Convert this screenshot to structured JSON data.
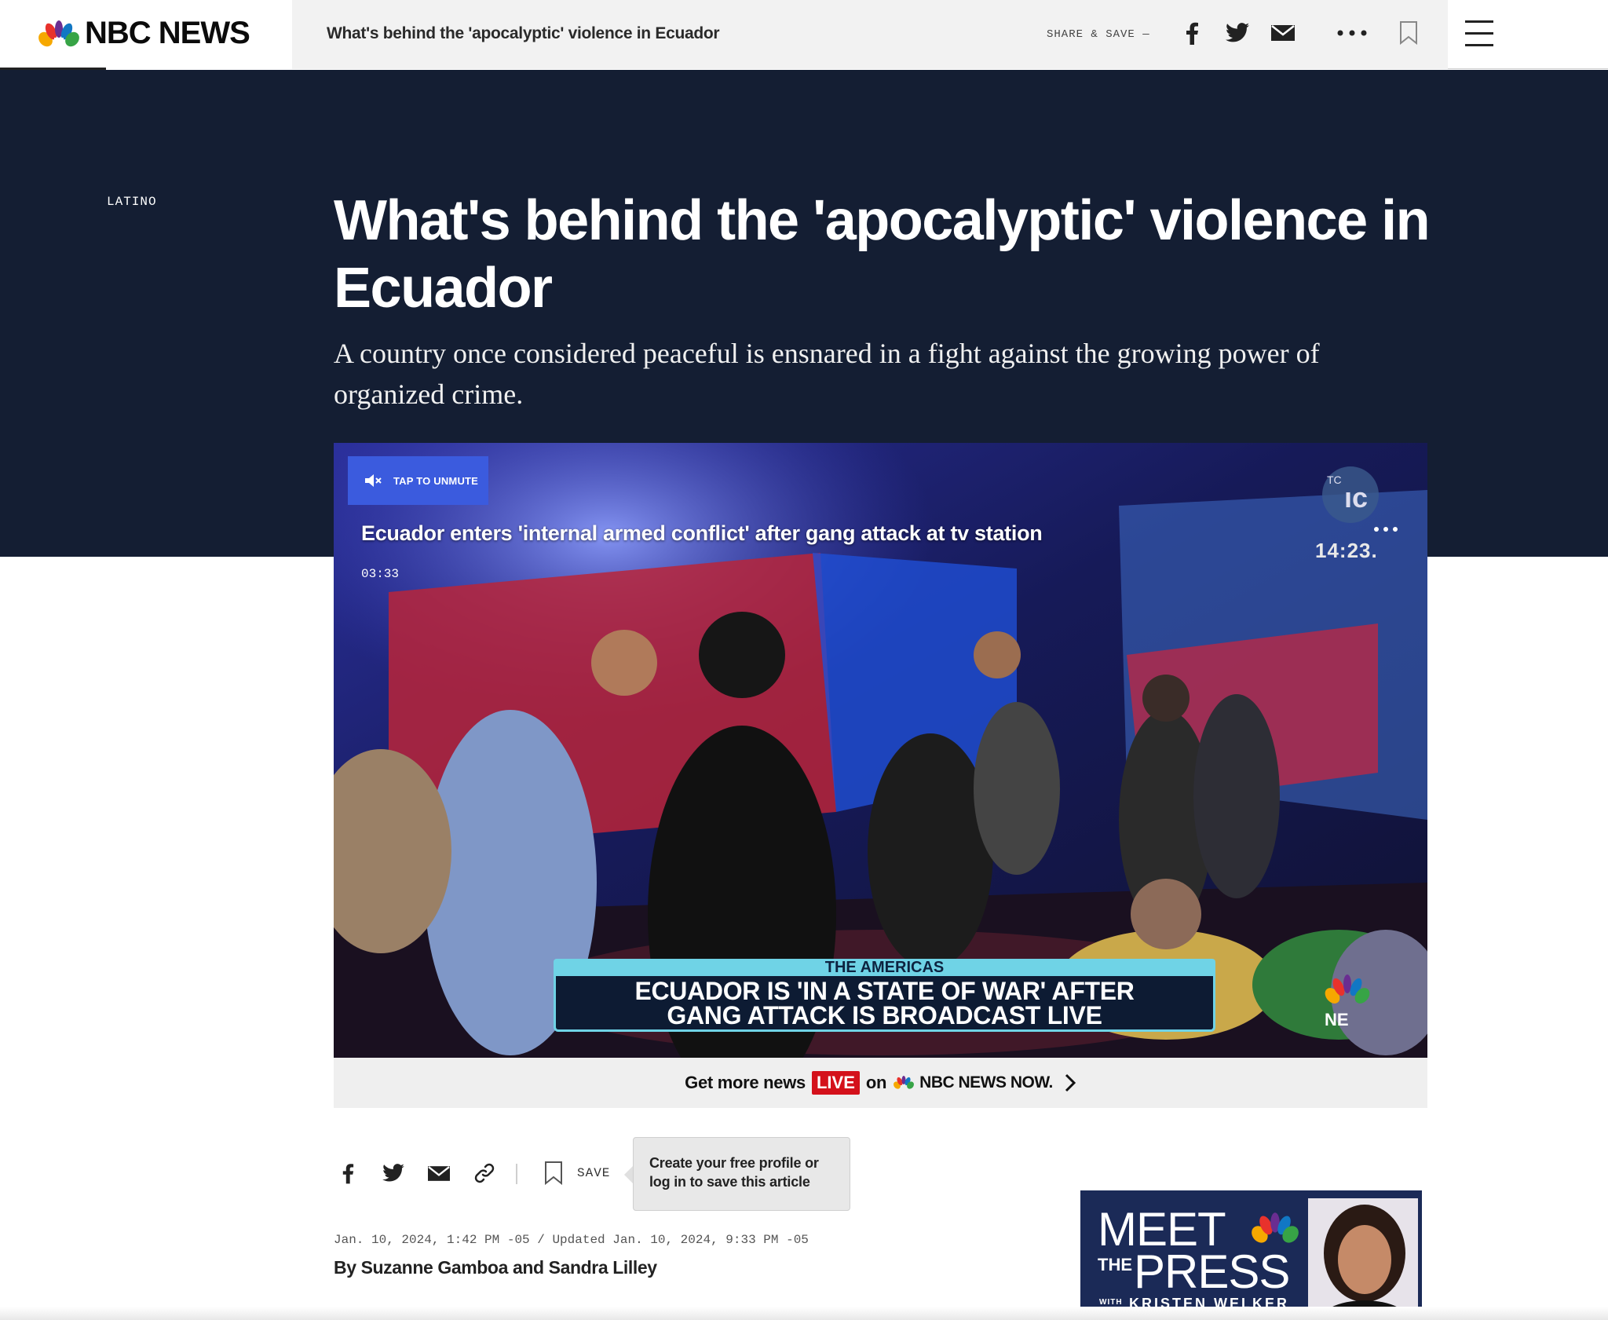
{
  "header": {
    "logo_text": "NBC NEWS",
    "sticky_title": "What's behind the 'apocalyptic' violence in Ecuador",
    "share_label": "SHARE & SAVE —",
    "icons": [
      "facebook-icon",
      "twitter-icon",
      "mail-icon",
      "more-icon",
      "bookmark-icon",
      "hamburger-menu-icon"
    ]
  },
  "article": {
    "section": "LATINO",
    "headline": "What's behind the 'apocalyptic' violence in Ecuador",
    "dek": "A country once considered peaceful is ensnared in a fight against the growing power of organized crime.",
    "dateline": "Jan. 10, 2024, 1:42 PM -05 / Updated Jan. 10, 2024, 9:33 PM -05",
    "byline": "By Suzanne Gamboa and Sandra Lilley"
  },
  "video": {
    "unmute_label": "TAP TO UNMUTE",
    "title": "Ecuador enters 'internal armed conflict' after gang attack at tv station",
    "duration": "03:33",
    "broadcast_logo": "TC",
    "broadcast_time": "14:23.",
    "lower_third_kicker": "THE AMERICAS",
    "lower_third_line1": "ECUADOR IS 'IN A STATE OF WAR' AFTER",
    "lower_third_line2": "GANG ATTACK IS BROADCAST LIVE",
    "bug_text": "NE"
  },
  "promo": {
    "text_before": "Get more news",
    "live": "LIVE",
    "text_on": "on",
    "brand": "NBC NEWS NOW."
  },
  "share_bar": {
    "save_label": "SAVE",
    "tooltip": "Create your free profile or log in to save this article"
  },
  "ad": {
    "line1": "MEET",
    "line2_small": "THE",
    "line2": "PRESS",
    "with": "WITH",
    "host": "KRISTEN WELKER"
  },
  "colors": {
    "hero_bg": "#141e33",
    "unmute_bg": "#3b5bde",
    "live_red": "#d4111b",
    "lower_third_cyan": "#6fd3e6"
  }
}
